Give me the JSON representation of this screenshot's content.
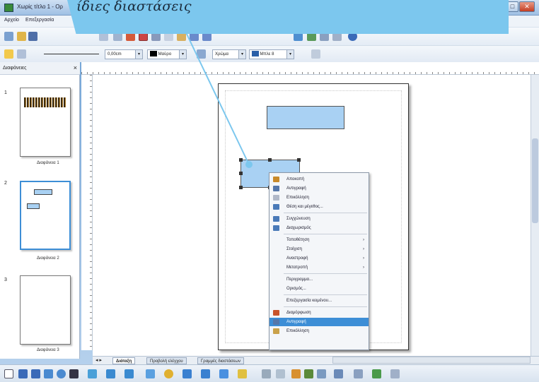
{
  "window": {
    "title": "Χωρίς τίτλο 1 - Ορ",
    "buttons": [
      "–",
      "□",
      "✕"
    ]
  },
  "callout": {
    "text": "ίδιες διαστάσεις"
  },
  "menubar": {
    "items": [
      "Αρχείο",
      "Επεξεργασία"
    ]
  },
  "toolbar": {
    "line_width": "0,00cm",
    "color_name": "Μαύρο",
    "fill_type": "Χρώμα",
    "fill_color": "Μπλε 8"
  },
  "slides_pane": {
    "title": "Διαφάνειες",
    "slides": [
      {
        "number": "1",
        "label": "Διαφάνεια 1"
      },
      {
        "number": "2",
        "label": "Διαφάνεια 2"
      },
      {
        "number": "3",
        "label": "Διαφάνεια 3"
      }
    ]
  },
  "context_menu": {
    "items": [
      {
        "label": "Αποκοπή",
        "icon": "scissors-icon",
        "color": "#c98a2a"
      },
      {
        "label": "Αντιγραφή",
        "icon": "copy-icon",
        "color": "#5577aa"
      },
      {
        "label": "Επικόλληση",
        "icon": "paste-icon",
        "color": "#b0b8c8"
      },
      {
        "label": "Θέση και μέγεθος...",
        "icon": "position-size-icon",
        "color": "#4a7ab8",
        "sep_after": true
      },
      {
        "label": "Συγχώνευση",
        "icon": "merge-icon",
        "color": "#4a7ab8"
      },
      {
        "label": "Διαχωρισμός",
        "icon": "split-icon",
        "color": "#4a7ab8",
        "sep_after": true
      },
      {
        "label": "Τοποθέτηση",
        "submenu": true
      },
      {
        "label": "Στοίχιση",
        "submenu": true
      },
      {
        "label": "Αναστροφή",
        "submenu": true
      },
      {
        "label": "Μετατροπή",
        "submenu": true,
        "sep_after": true
      },
      {
        "label": "Περιγραμμα...",
        "submenu": false
      },
      {
        "label": "Ορισμός...",
        "submenu": false,
        "sep_after": true
      },
      {
        "label": "Επεξεργασία κειμένου...",
        "submenu": false,
        "sep_after": true
      },
      {
        "label": "Διαμόρφωση",
        "icon": "format-icon",
        "color": "#c9542a"
      },
      {
        "label": "Αντιγραφή",
        "icon": "copy-icon",
        "color": "#5577aa",
        "highlight": true
      },
      {
        "label": "Επικόλληση",
        "icon": "paste-icon",
        "color": "#caa24a"
      }
    ]
  },
  "tabs": [
    "Διάταξη",
    "Προβολή ελέγχου",
    "Γραμμές διαστάσεων"
  ],
  "colors": {
    "shape_fill": "#a9d1f3",
    "callout": "#7cc7ee",
    "highlight": "#3d8ed6"
  }
}
